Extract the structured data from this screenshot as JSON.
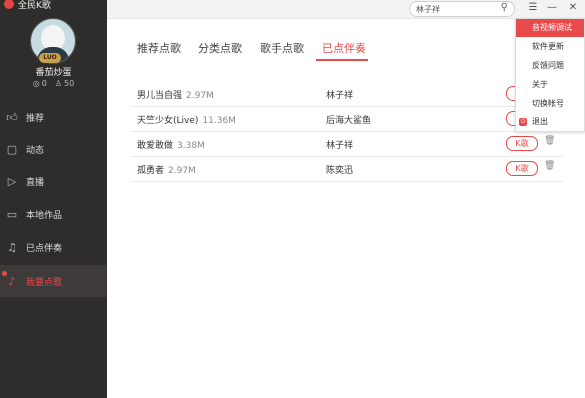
{
  "app": {
    "title": "全民K歌"
  },
  "profile": {
    "username": "番茄炒蛋",
    "level_badge": "LUO",
    "stat1": "0",
    "stat2": "50"
  },
  "sidebar": {
    "items": [
      {
        "label": "推荐",
        "icon": "thumb-icon"
      },
      {
        "label": "动态",
        "icon": "chat-icon"
      },
      {
        "label": "直播",
        "icon": "tv-icon"
      },
      {
        "label": "本地作品",
        "icon": "monitor-icon"
      },
      {
        "label": "已点伴奏",
        "icon": "list-icon"
      },
      {
        "label": "我要点歌",
        "icon": "mic-icon"
      }
    ],
    "active_index": 5
  },
  "search": {
    "value": "林子祥"
  },
  "tabs": [
    {
      "label": "推荐点歌"
    },
    {
      "label": "分类点歌"
    },
    {
      "label": "歌手点歌"
    },
    {
      "label": "已点伴奏"
    }
  ],
  "songs": [
    {
      "title": "男儿当自强",
      "size": "2.97M",
      "artist": "林子祥",
      "k_label": "K歌"
    },
    {
      "title": "天竺少女(Live)",
      "size": "11.36M",
      "artist": "后海大鲨鱼",
      "k_label": "K歌"
    },
    {
      "title": "敢爱敢做",
      "size": "3.38M",
      "artist": "林子祥",
      "k_label": "K歌"
    },
    {
      "title": "孤勇者",
      "size": "2.97M",
      "artist": "陈奕迅",
      "k_label": "K歌"
    }
  ],
  "menu": {
    "items": [
      {
        "label": "音视频调试"
      },
      {
        "label": "软件更新"
      },
      {
        "label": "反馈问题"
      },
      {
        "label": "关于"
      },
      {
        "label": "切换帐号"
      },
      {
        "label": "退出"
      }
    ]
  },
  "colors": {
    "accent": "#e84a4a",
    "sidebar_bg": "#2f2c2c"
  }
}
